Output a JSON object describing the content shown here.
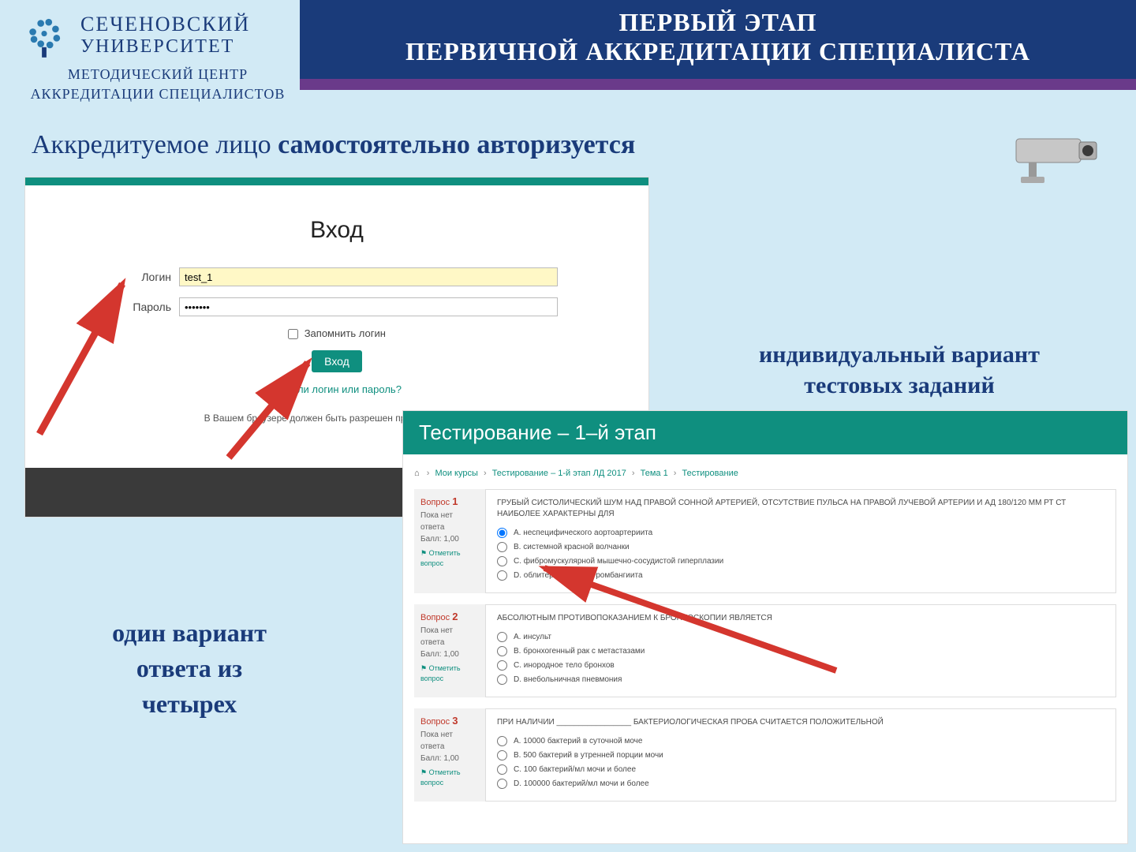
{
  "header": {
    "line1": "ПЕРВЫЙ ЭТАП",
    "line2": "ПЕРВИЧНОЙ АККРЕДИТАЦИИ СПЕЦИАЛИСТА"
  },
  "logo": {
    "line1": "СЕЧЕНОВСКИЙ",
    "line2": "УНИВЕРСИТЕТ",
    "sub1": "МЕТОДИЧЕСКИЙ ЦЕНТР",
    "sub2": "АККРЕДИТАЦИИ СПЕЦИАЛИСТОВ"
  },
  "subtitle": {
    "pre": "Аккредитуемое лицо ",
    "bold": "самостоятельно авторизуется"
  },
  "login": {
    "title": "Вход",
    "login_label": "Логин",
    "login_value": "test_1",
    "password_label": "Пароль",
    "password_value": "•••••••",
    "remember": "Запомнить логин",
    "submit": "Вход",
    "forgot": "Забыли логин или пароль?",
    "note": "В Вашем браузере должен быть разрешен прием cookies ⓘ"
  },
  "annot_right": {
    "l1": "индивидуальный вариант",
    "l2": "тестовых заданий"
  },
  "annot_left": {
    "l1": "один вариант",
    "l2": "ответа из",
    "l3": "четырех"
  },
  "test": {
    "header_bold": "Тестирование – 1–",
    "header_rest": "й этап",
    "breadcrumb": {
      "home": "⌂",
      "b1": "Мои курсы",
      "b2": "Тестирование – 1-й этап ЛД 2017",
      "b3": "Тема 1",
      "b4": "Тестирование"
    },
    "side": {
      "noanswer": "Пока нет ответа",
      "score": "Балл: 1,00",
      "flag": "⚑ Отметить вопрос",
      "qlabel": "Вопрос"
    },
    "questions": [
      {
        "num": "1",
        "text": "ГРУБЫЙ СИСТОЛИЧЕСКИЙ ШУМ НАД ПРАВОЙ СОННОЙ АРТЕРИЕЙ, ОТСУТСТВИЕ ПУЛЬСА НА ПРАВОЙ ЛУЧЕВОЙ АРТЕРИИ И АД 180/120 ММ РТ СТ НАИБОЛЕЕ ХАРАКТЕРНЫ ДЛЯ",
        "opts": [
          "A. неспецифического аортоартериита",
          "B. системной красной волчанки",
          "C. фибромускулярной мышечно-сосудистой гиперплазии",
          "D. облитерирующего тромбангиита"
        ]
      },
      {
        "num": "2",
        "text": "АБСОЛЮТНЫМ ПРОТИВОПОКАЗАНИЕМ К БРОНХОСКОПИИ ЯВЛЯЕТСЯ",
        "opts": [
          "A. инсульт",
          "B. бронхогенный рак с метастазами",
          "C. инородное тело бронхов",
          "D. внебольничная пневмония"
        ]
      },
      {
        "num": "3",
        "text": "ПРИ НАЛИЧИИ _________________ БАКТЕРИОЛОГИЧЕСКАЯ ПРОБА СЧИТАЕТСЯ ПОЛОЖИТЕЛЬНОЙ",
        "opts": [
          "A. 10000 бактерий в суточной моче",
          "B. 500 бактерий в утренней порции мочи",
          "C. 100 бактерий/мл мочи и более",
          "D. 100000 бактерий/мл мочи и более"
        ]
      }
    ]
  }
}
